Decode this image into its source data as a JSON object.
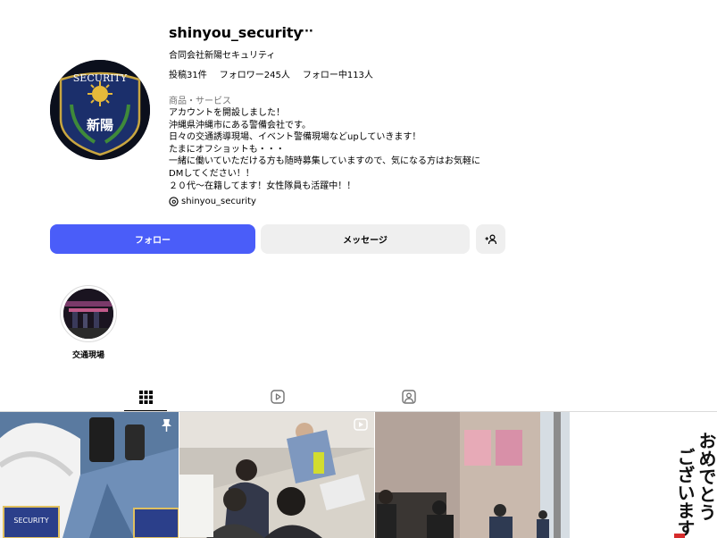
{
  "profile": {
    "username": "shinyou_security",
    "more_label": "···",
    "full_name": "合同会社新陽セキュリティ",
    "stats": {
      "posts": "投稿31件",
      "followers": "フォロワー245人",
      "following": "フォロー中113人"
    },
    "category": "商品・サービス",
    "bio_lines": [
      "アカウントを開設しました！",
      "沖縄県沖縄市にある警備会社です。",
      "日々の交通誘導現場、イベント警備現場などupしていきます！",
      "たまにオフショットも・・・",
      "一緒に働いていただける方も随時募集していますので、気になる方はお気軽に",
      "DMしてください！！",
      "２０代〜在籍してます！女性隊員も活躍中！！"
    ],
    "threads_handle": "shinyou_security",
    "avatar_text": {
      "top": "SECURITY",
      "bottom": "新陽"
    }
  },
  "actions": {
    "follow": "フォロー",
    "message": "メッセージ",
    "add_user_icon": "person-add-icon"
  },
  "highlights": [
    {
      "label": "交通現場"
    }
  ],
  "tabs": [
    {
      "name": "posts",
      "icon": "grid-icon",
      "active": true
    },
    {
      "name": "reels",
      "icon": "reels-icon",
      "active": false
    },
    {
      "name": "tagged",
      "icon": "tagged-icon",
      "active": false
    }
  ],
  "posts": [
    {
      "pinned": true,
      "type": "image",
      "badge_text": "SECURITY"
    },
    {
      "pinned": false,
      "type": "reel"
    },
    {
      "pinned": false,
      "type": "image"
    },
    {
      "pinned": false,
      "type": "image",
      "calligraphy": [
        "おめでとう",
        "ございます"
      ]
    }
  ],
  "colors": {
    "follow_button": "#4a5df9",
    "secondary_button": "#efefef",
    "muted_text": "#737373"
  }
}
